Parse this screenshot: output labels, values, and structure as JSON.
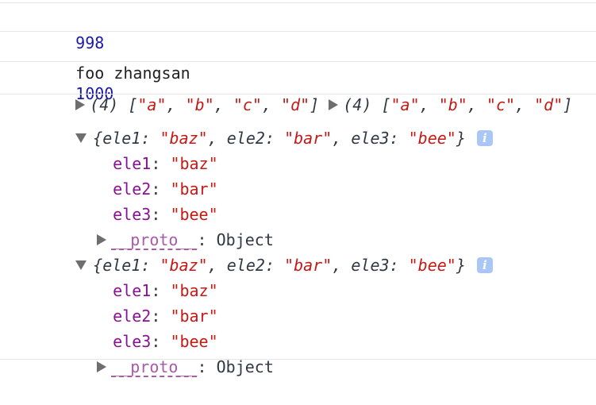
{
  "console": {
    "line1": {
      "num_a": "998",
      "num_b": "1000"
    },
    "line2": {
      "text": "foo zhangsan"
    },
    "line3": {
      "array_a": {
        "length_prefix": "(4) ",
        "open": "[",
        "items": [
          "\"a\"",
          "\"b\"",
          "\"c\"",
          "\"d\""
        ],
        "close": "]"
      },
      "array_b": {
        "length_prefix": "(4) ",
        "open": "[",
        "items": [
          "\"a\"",
          "\"b\"",
          "\"c\"",
          "\"d\""
        ],
        "close": "]"
      }
    },
    "objects": [
      {
        "summary": {
          "open": "{",
          "close": "}",
          "pairs": [
            {
              "key": "ele1",
              "value": "\"baz\""
            },
            {
              "key": "ele2",
              "value": "\"bar\""
            },
            {
              "key": "ele3",
              "value": "\"bee\""
            }
          ]
        },
        "info_badge": "i",
        "props": [
          {
            "key": "ele1",
            "value": "\"baz\""
          },
          {
            "key": "ele2",
            "value": "\"bar\""
          },
          {
            "key": "ele3",
            "value": "\"bee\""
          }
        ],
        "proto": {
          "key": "__proto__",
          "value": "Object"
        }
      },
      {
        "summary": {
          "open": "{",
          "close": "}",
          "pairs": [
            {
              "key": "ele1",
              "value": "\"baz\""
            },
            {
              "key": "ele2",
              "value": "\"bar\""
            },
            {
              "key": "ele3",
              "value": "\"bee\""
            }
          ]
        },
        "info_badge": "i",
        "props": [
          {
            "key": "ele1",
            "value": "\"baz\""
          },
          {
            "key": "ele2",
            "value": "\"bar\""
          },
          {
            "key": "ele3",
            "value": "\"bee\""
          }
        ],
        "proto": {
          "key": "__proto__",
          "value": "Object"
        }
      }
    ]
  },
  "colors": {
    "number": "#1a1aa6",
    "string": "#c41a16",
    "key": "#881391",
    "proto": "#a95ba8",
    "expander": "#6e6e6e",
    "info_badge": "#a9c6f5"
  },
  "icons": {
    "expand_collapsed": "triangle-right-icon",
    "expand_open": "triangle-down-icon",
    "info": "info-icon"
  }
}
